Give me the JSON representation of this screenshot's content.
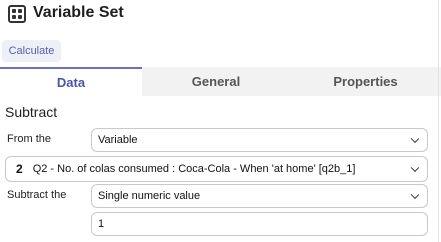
{
  "header": {
    "title": "Variable Set"
  },
  "toolbar": {
    "calculate_label": "Calculate"
  },
  "tabs": [
    {
      "label": "Data",
      "active": true
    },
    {
      "label": "General",
      "active": false
    },
    {
      "label": "Properties",
      "active": false
    }
  ],
  "section": {
    "title": "Subtract"
  },
  "from_row": {
    "label": "From the",
    "value": "Variable"
  },
  "variable_row": {
    "number": "2",
    "value": "Q2 - No. of colas consumed : Coca-Cola - When 'at home' [q2b_1]"
  },
  "subtract_row": {
    "label": "Subtract the",
    "value": "Single numeric value"
  },
  "value_input": {
    "value": "1"
  },
  "colors": {
    "accent": "#6a6fc0",
    "accent_text": "#4a55a8",
    "tab_bg": "#f2f2f2",
    "button_bg": "#eef0f8"
  }
}
